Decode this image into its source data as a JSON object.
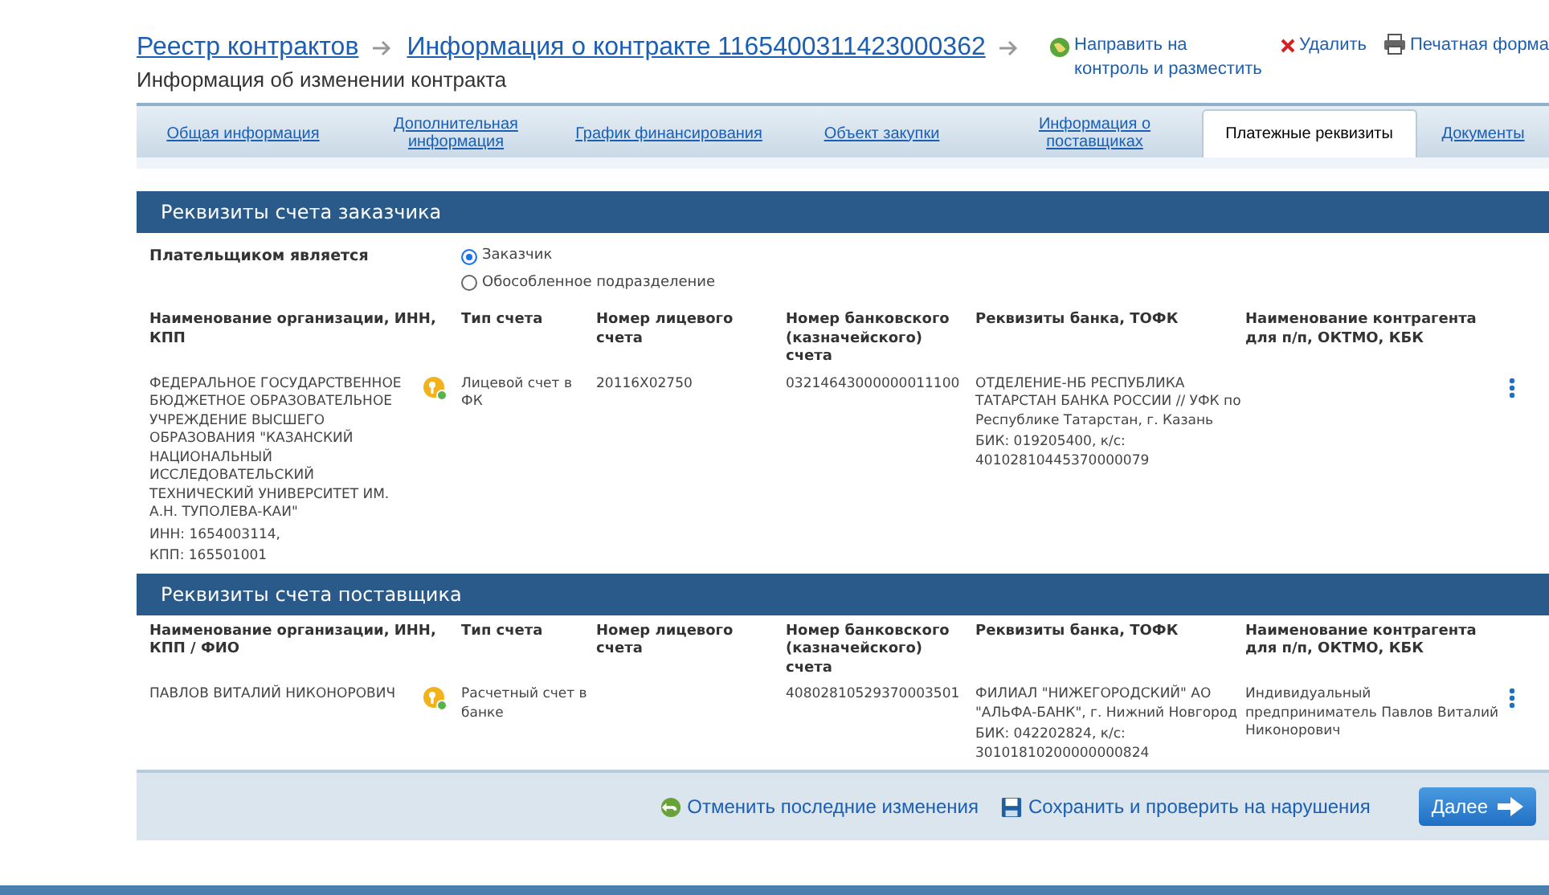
{
  "breadcrumbs": [
    {
      "label": "Реестр контрактов"
    },
    {
      "label": "Информация о контракте 1165400311423000362"
    }
  ],
  "subtitle": "Информация об изменении контракта",
  "actions": [
    {
      "kind": "send",
      "label": "Направить на контроль и разместить"
    },
    {
      "kind": "delete",
      "label": "Удалить"
    },
    {
      "kind": "print",
      "label": "Печатная форма"
    }
  ],
  "tabs": [
    {
      "label": "Общая информация",
      "selected": false
    },
    {
      "label": "Дополнительная информация",
      "selected": false
    },
    {
      "label": "График финансирования",
      "selected": false
    },
    {
      "label": "Объект закупки",
      "selected": false
    },
    {
      "label": "Информация о поставщиках",
      "selected": false
    },
    {
      "label": "Платежные реквизиты",
      "selected": true
    },
    {
      "label": "Документы",
      "selected": false
    }
  ],
  "sections": [
    {
      "title": "Реквизиты счета заказчика",
      "payer": {
        "label": "Плательщиком является",
        "options": [
          {
            "label": "Заказчик",
            "selected": true
          },
          {
            "label": "Обособленное подразделение",
            "selected": false
          }
        ]
      },
      "columns": [
        "Наименование организации, ИНН, КПП",
        "Тип счета",
        "Номер лицевого счета",
        "Номер банковского (казначейского) счета",
        "Реквизиты банка, ТОФК",
        "Наименование контрагента для п/п, ОКТМО, КБК"
      ],
      "rows": [
        {
          "organization": "ФЕДЕРАЛЬНОЕ ГОСУДАРСТВЕННОЕ БЮДЖЕТНОЕ ОБРАЗОВАТЕЛЬНОЕ УЧРЕЖДЕНИЕ ВЫСШЕГО ОБРАЗОВАНИЯ \"КАЗАНСКИЙ НАЦИОНАЛЬНЫЙ ИССЛЕДОВАТЕЛЬСКИЙ ТЕХНИЧЕСКИЙ УНИВЕРСИТЕТ ИМ. А.Н. ТУПОЛЕВА-КАИ\"",
          "details": [
            "ИНН: 1654003114,",
            "КПП: 165501001"
          ],
          "account_type": "Лицевой счет в ФК",
          "personal_account": "20116X02750",
          "bank_account": "03214643000000011100",
          "bank": "ОТДЕЛЕНИЕ-НБ РЕСПУБЛИКА ТАТАРСТАН БАНКА РОССИИ // УФК по Республике Татарстан, г. Казань",
          "bank_codes": "БИК: 019205400, к/с: 40102810445370000079"
        }
      ]
    },
    {
      "title": "Реквизиты счета поставщика",
      "columns": [
        "Наименование организации, ИНН, КПП / ФИО",
        "Тип счета",
        "Номер лицевого счета",
        "Номер банковского (казначейского) счета",
        "Реквизиты банка, ТОФК",
        "Наименование контрагента для п/п, ОКТМО, КБК"
      ],
      "rows": [
        {
          "organization": "ПАВЛОВ ВИТАЛИЙ НИКОНОРОВИЧ",
          "account_type": "Расчетный счет в банке",
          "bank_account": "40802810529370003501",
          "bank": "ФИЛИАЛ \"НИЖЕГОРОДСКИЙ\" АО \"АЛЬФА-БАНК\", г. Нижний Новгород",
          "bank_codes": "БИК: 042202824, к/с: 30101810200000000824",
          "counterparty": "Индивидуальный предприниматель Павлов Виталий Никонорович"
        }
      ]
    }
  ],
  "footer": {
    "actions": [
      {
        "kind": "undo",
        "label": "Отменить последние изменения"
      },
      {
        "kind": "save",
        "label": "Сохранить и проверить на нарушения"
      }
    ],
    "next_button": "Далее"
  }
}
